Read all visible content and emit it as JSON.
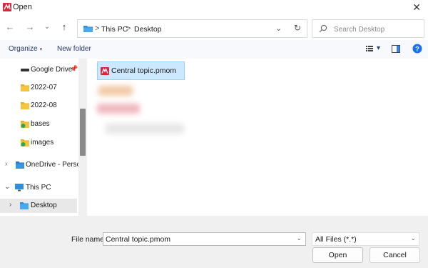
{
  "window": {
    "title": "Open",
    "close_symbol": "✕"
  },
  "nav": {
    "back_symbol": "←",
    "forward_symbol": "→",
    "recent_symbol": "⌄",
    "up_symbol": "↑",
    "breadcrumb": [
      "This PC",
      "Desktop"
    ],
    "crumb_separator": ">",
    "dropdown_symbol": "⌄",
    "refresh_symbol": "↻",
    "search_placeholder": "Search Desktop"
  },
  "toolbar": {
    "organize_label": "Organize",
    "organize_caret": "▾",
    "new_folder_label": "New folder",
    "view_caret": "▾"
  },
  "sidebar": {
    "items": [
      {
        "label": "Google Drive",
        "icon": "drive-icon",
        "pinned": true
      },
      {
        "label": "2022-07",
        "icon": "folder-icon"
      },
      {
        "label": "2022-08",
        "icon": "folder-icon"
      },
      {
        "label": "bases",
        "icon": "synced-folder-icon"
      },
      {
        "label": "images",
        "icon": "synced-folder-icon"
      },
      {
        "label": "OneDrive - Perso",
        "icon": "onedrive-icon",
        "chevron": "›"
      },
      {
        "label": "This PC",
        "icon": "pc-icon",
        "chevron": "⌄"
      },
      {
        "label": "Desktop",
        "icon": "desktop-folder-icon",
        "chevron": "›",
        "selected": true
      }
    ],
    "pin_symbol": "📌"
  },
  "files": {
    "selected": {
      "name": "Central topic.pmom"
    }
  },
  "footer": {
    "file_name_label": "File name:",
    "file_name_value": "Central topic.pmom",
    "file_type_value": "All Files (*.*)",
    "open_label": "Open",
    "cancel_label": "Cancel",
    "dropdown_symbol": "⌄"
  },
  "colors": {
    "selection_bg": "#cce8ff",
    "selection_border": "#99d1ff",
    "folder_yellow": "#f5c542",
    "folder_blue": "#2f8fd8",
    "app_red": "#d7263d",
    "help_blue": "#1a73e8"
  }
}
